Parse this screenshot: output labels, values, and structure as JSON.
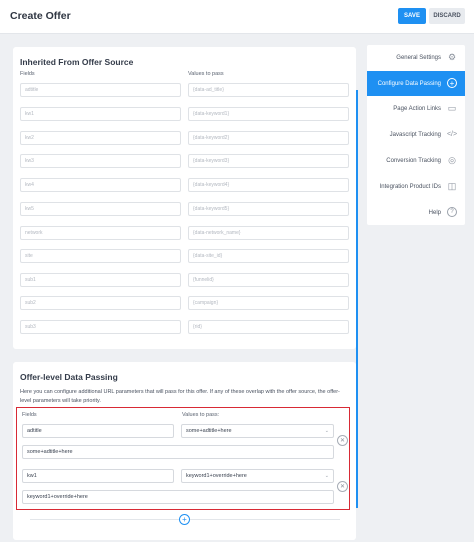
{
  "header": {
    "title": "Create Offer",
    "save_label": "SAVE",
    "discard_label": "DISCARD"
  },
  "inherited": {
    "title": "Inherited From Offer Source",
    "fields_label": "Fields",
    "values_label": "Values to pass",
    "rows": [
      {
        "field": "adtitle",
        "value": "{data-ad_title}"
      },
      {
        "field": "kw1",
        "value": "{data-keyword1}"
      },
      {
        "field": "kw2",
        "value": "{data-keyword2}"
      },
      {
        "field": "kw3",
        "value": "{data-keyword3}"
      },
      {
        "field": "kw4",
        "value": "{data-keyword4}"
      },
      {
        "field": "kw5",
        "value": "{data-keyword5}"
      },
      {
        "field": "network",
        "value": "{data-network_name}"
      },
      {
        "field": "site",
        "value": "{data-site_id}"
      },
      {
        "field": "sub1",
        "value": "{funnelid}"
      },
      {
        "field": "sub2",
        "value": "{campaign}"
      },
      {
        "field": "sub3",
        "value": "{rid}"
      }
    ]
  },
  "offer_level": {
    "title": "Offer-level Data Passing",
    "description": "Here you can configure additional URL parameters that will pass for this offer. If any of these overlap with the offer source, the offer-level parameters will take priority.",
    "fields_label": "Fields",
    "values_label": "Values to pass:",
    "params": [
      {
        "field": "adtitle",
        "select_value": "some+adtitle+here",
        "custom_value": "some+adtitle+here"
      },
      {
        "field": "kw1",
        "select_value": "keyword1+override+here",
        "custom_value": "keyword1+override+here"
      }
    ]
  },
  "nav": {
    "items": [
      {
        "label": "General Settings",
        "icon": "gear-icon",
        "active": false
      },
      {
        "label": "Configure Data Passing",
        "icon": "plus-circle-icon",
        "active": true
      },
      {
        "label": "Page Action Links",
        "icon": "link-icon",
        "active": false
      },
      {
        "label": "Javascript Tracking",
        "icon": "code-icon",
        "active": false
      },
      {
        "label": "Conversion Tracking",
        "icon": "target-icon",
        "active": false
      },
      {
        "label": "Integration Product IDs",
        "icon": "cube-icon",
        "active": false
      },
      {
        "label": "Help",
        "icon": "help-icon",
        "active": false
      }
    ]
  },
  "colors": {
    "accent": "#1e90f2",
    "highlight": "#d82a35"
  }
}
